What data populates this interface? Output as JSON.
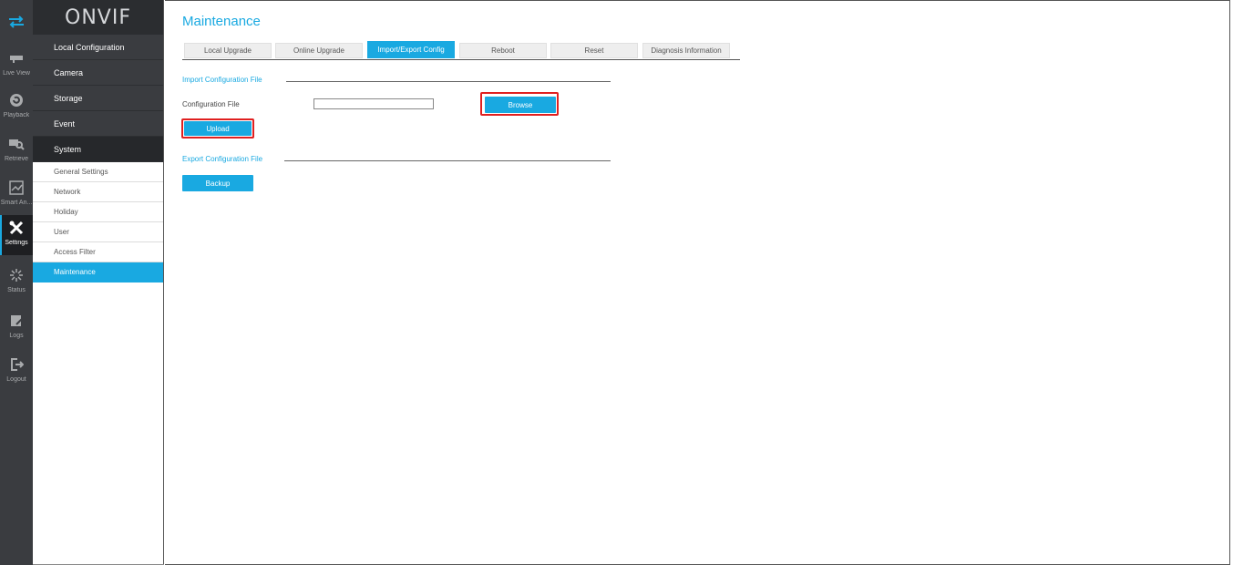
{
  "rail": [
    {
      "name": "top",
      "label": "",
      "icon": "swap-arrows-icon"
    },
    {
      "name": "live-view",
      "label": "Live View",
      "icon": "camera-icon"
    },
    {
      "name": "playback",
      "label": "Playback",
      "icon": "playback-icon"
    },
    {
      "name": "retrieve",
      "label": "Retrieve",
      "icon": "retrieve-icon"
    },
    {
      "name": "smart-analysis",
      "label": "Smart An...",
      "icon": "smart-analysis-icon"
    },
    {
      "name": "settings",
      "label": "Settings",
      "icon": "tools-icon",
      "active": true
    },
    {
      "name": "status",
      "label": "Status",
      "icon": "status-icon"
    },
    {
      "name": "logs",
      "label": "Logs",
      "icon": "logs-icon"
    },
    {
      "name": "logout",
      "label": "Logout",
      "icon": "logout-icon"
    }
  ],
  "brand": {
    "logo_text": "ONVIF"
  },
  "nav": {
    "sections": [
      "Local Configuration",
      "Camera",
      "Storage",
      "Event",
      "System"
    ],
    "system_items": [
      "General Settings",
      "Network",
      "Holiday",
      "User",
      "Access Filter",
      "Maintenance"
    ],
    "active_item": "Maintenance"
  },
  "page": {
    "title": "Maintenance"
  },
  "tabs": [
    "Local Upgrade",
    "Online Upgrade",
    "Import/Export Config",
    "Reboot",
    "Reset",
    "Diagnosis Information"
  ],
  "active_tab": "Import/Export Config",
  "import_section": {
    "title": "Import Configuration File",
    "field_label": "Configuration File",
    "file_value": "",
    "browse_label": "Browse",
    "upload_label": "Upload"
  },
  "export_section": {
    "title": "Export Configuration File",
    "backup_label": "Backup"
  },
  "colors": {
    "accent": "#19a9e1",
    "highlight": "#e02020",
    "rail_bg": "#3a3c40"
  }
}
